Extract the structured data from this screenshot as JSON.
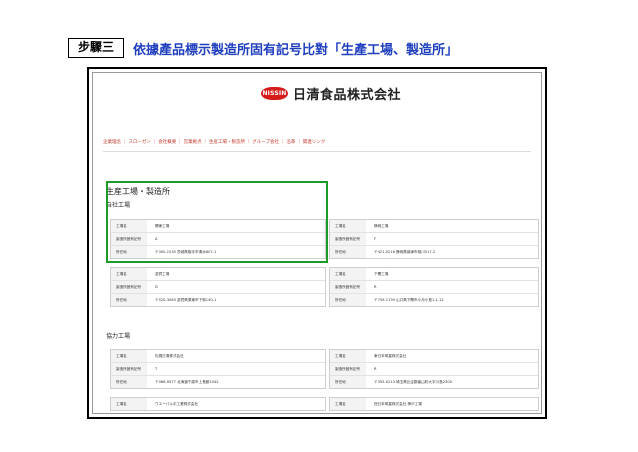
{
  "step": {
    "label": "步驟三",
    "instruction": "依據產品標示製造所固有記号比對「生產工場、製造所」"
  },
  "screenshot": {
    "logo": {
      "badge": "NISSIN",
      "name": "日清食品株式会社"
    },
    "nav": "企業理念 ｜ スローガン ｜ 会社概要 ｜ 営業拠点 ｜ 生産工場・製造所 ｜ グループ会社 ｜ 沿革 ｜ 関連リンク",
    "page_title": "生産工場・製造所",
    "section_own": "自社工場",
    "section_partner": "協力工場",
    "labels": {
      "name": "工場名",
      "code": "製造所固有記号",
      "address": "所在地"
    },
    "own_factories": [
      {
        "name": "関東工場",
        "code": "A",
        "address": "〒300-1535 茨城県取手市清水607-1"
      },
      {
        "name": "静岡工場",
        "code": "F",
        "address": "〒421-0216 静岡県焼津市相川517-2"
      },
      {
        "name": "滋賀工場",
        "code": "D",
        "address": "〒520-3083 滋賀県栗東市下鈎140-1"
      },
      {
        "name": "下関工場",
        "code": "R",
        "address": "〒759-1139 山口県下関市小月小島1-1-12"
      }
    ],
    "partner_factories": [
      {
        "name": "札幌日清株式会社",
        "code": "T",
        "address": "〒066-0077 北海道千歳市上長都1042"
      },
      {
        "name": "東日本明星株式会社",
        "code": "R",
        "address": "〒355-0213 埼玉県比企郡嵐山町大字川島2300"
      },
      {
        "name": "ウエーパル中工業株式会社",
        "code": "",
        "address": ""
      },
      {
        "name": "西日本明星株式会社 神戸工場",
        "code": "",
        "address": ""
      }
    ]
  },
  "colors": {
    "instruction": "#1f3fbf",
    "highlight": "#1e9a28",
    "brand": "#d61b1b",
    "nav": "#c0392b"
  }
}
